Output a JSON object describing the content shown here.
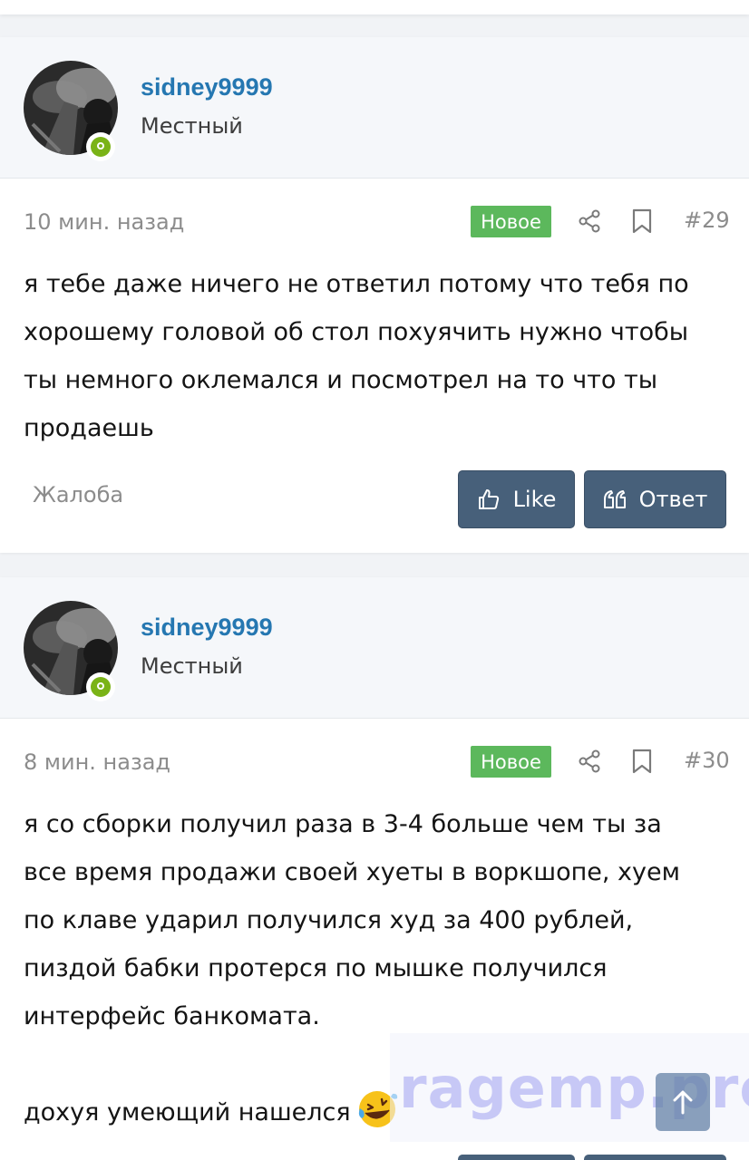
{
  "posts": [
    {
      "username": "sidney9999",
      "user_title": "Местный",
      "time": "10 мин. назад",
      "badge": "Новое",
      "number": "#29",
      "lines": [
        "я тебе даже ничего не ответил потому что тебя по",
        "хорошему головой об стол похуячить нужно чтобы",
        "ты немного оклемался и посмотрел на то что ты",
        "продаешь"
      ],
      "report": "Жалоба",
      "like": "Like",
      "reply": "Ответ"
    },
    {
      "username": "sidney9999",
      "user_title": "Местный",
      "time": "8 мин. назад",
      "badge": "Новое",
      "number": "#30",
      "lines": [
        "я со сборки получил раза в 3-4 больше чем ты за",
        "все время продажи своей хуеты в воркшопе, хуем",
        "по клаве ударил получился худ за 400 рублей,",
        "пиздой бабки протерся по мышке получился",
        "интерфейс банкомата.",
        "",
        "дохуя умеющий нашелся"
      ],
      "emoji": "rolling-on-floor-laughing-emoji"
    }
  ],
  "watermark": "ragemp.pro",
  "icons": {
    "share": "share-icon",
    "bookmark": "bookmark-icon",
    "like": "thumbs-up-icon",
    "reply": "quote-icon",
    "scroll": "arrow-up-icon"
  },
  "colors": {
    "username": "#2577b1",
    "badge": "#5cb85c",
    "button": "#47607a",
    "online": "#7ab317"
  }
}
